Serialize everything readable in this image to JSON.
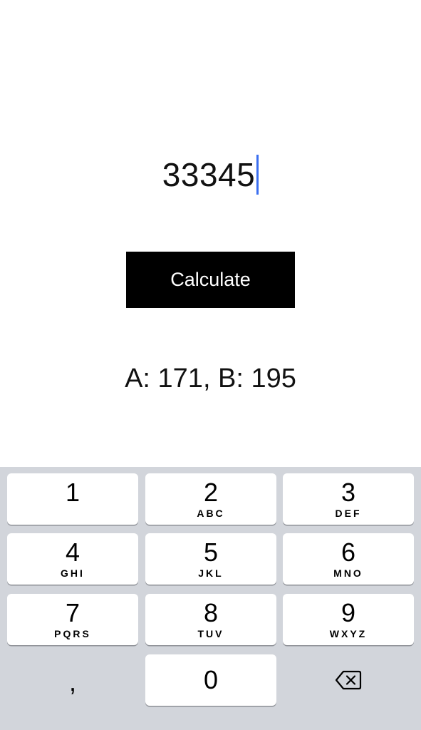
{
  "input": {
    "value": "33345"
  },
  "calculate_button": {
    "label": "Calculate"
  },
  "result": {
    "text": "A: 171, B: 195"
  },
  "keypad": {
    "keys": [
      {
        "digit": "1",
        "letters": ""
      },
      {
        "digit": "2",
        "letters": "ABC"
      },
      {
        "digit": "3",
        "letters": "DEF"
      },
      {
        "digit": "4",
        "letters": "GHI"
      },
      {
        "digit": "5",
        "letters": "JKL"
      },
      {
        "digit": "6",
        "letters": "MNO"
      },
      {
        "digit": "7",
        "letters": "PQRS"
      },
      {
        "digit": "8",
        "letters": "TUV"
      },
      {
        "digit": "9",
        "letters": "WXYZ"
      }
    ],
    "comma_key": ",",
    "zero_key": "0",
    "backspace_icon": "delete-backward-icon"
  },
  "colors": {
    "caret": "#3b6ff0",
    "button_bg": "#000000",
    "button_text": "#ffffff",
    "keyboard_bg": "#d2d5db",
    "key_bg": "#ffffff"
  }
}
